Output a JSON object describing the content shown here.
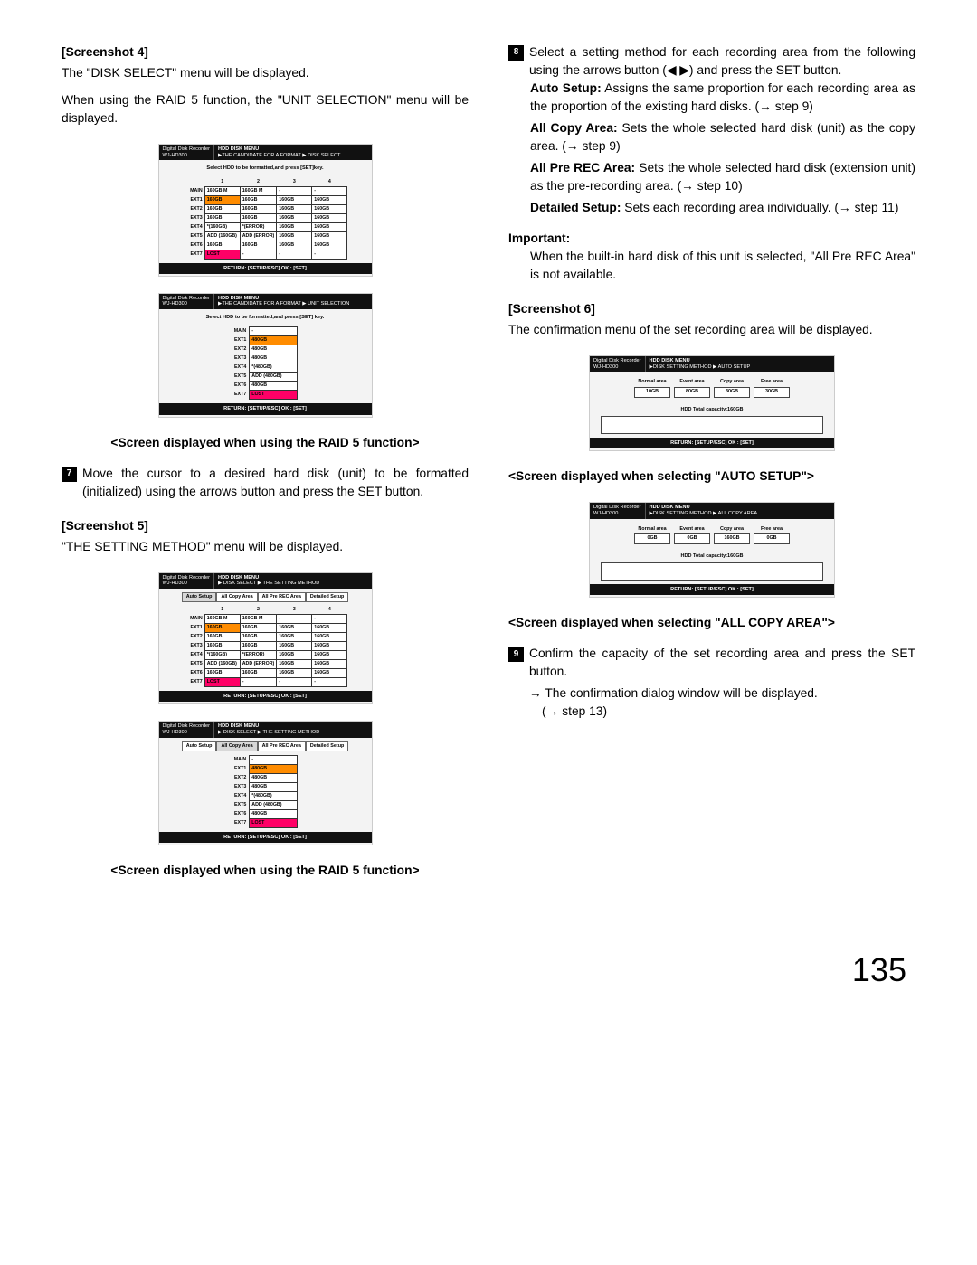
{
  "left": {
    "h4": "[Screenshot 4]",
    "p4a": "The \"DISK SELECT\" menu will be displayed.",
    "p4b": "When using the RAID 5 function, the \"UNIT SELECTION\" menu will be displayed.",
    "caption_raid_a": "<Screen displayed when using the RAID 5 function>",
    "step7": "Move the cursor to a desired hard disk (unit) to be formatted (initialized) using the arrows button and press the SET button.",
    "h5": "[Screenshot 5]",
    "p5": "\"THE SETTING METHOD\" menu will be displayed.",
    "caption_raid_b": "<Screen displayed when using the RAID 5 function>"
  },
  "right": {
    "step8": "Select a setting method for each recording area from the following using the arrows button (◀ ▶) and press the SET button.",
    "defs": {
      "auto": {
        "term": "Auto Setup:",
        "body": " Assigns the same proportion for each recording area as the proportion of the existing hard disks. (→ step 9)"
      },
      "allcopy": {
        "term": "All Copy Area:",
        "body": " Sets the whole selected hard disk (unit) as the copy area. (→ step 9)"
      },
      "allpre": {
        "term": "All Pre REC Area:",
        "body": " Sets the whole selected hard disk (extension unit) as the pre-recording area. (→ step 10)"
      },
      "detailed": {
        "term": "Detailed Setup:",
        "body": " Sets each recording area individually. (→ step 11)"
      }
    },
    "important_label": "Important:",
    "important_body": "When the built-in hard disk of this unit is selected, \"All Pre REC Area\" is not available.",
    "h6": "[Screenshot 6]",
    "p6": "The confirmation menu of the set recording area will be displayed.",
    "caption_auto": "<Screen displayed when selecting \"AUTO SETUP\">",
    "caption_copy": "<Screen displayed when selecting \"ALL COPY AREA\">",
    "step9": "Confirm the capacity of the set recording area and press the SET button.",
    "step9a": "→ The confirmation dialog window will be displayed.",
    "step9b": "(→ step 13)"
  },
  "screens": {
    "common": {
      "rec_label": "Digital Disk Recorder",
      "model": "WJ-HD300",
      "menu_title": "HDD DISK MENU",
      "returnbar": "RETURN: [SETUP/ESC] OK : [SET]"
    },
    "diskselect": {
      "path": "▶THE CANDIDATE FOR A FORMAT ▶ DISK SELECT",
      "instr": "Select HDD to be formatted,and press [SET]key.",
      "cols": [
        "1",
        "2",
        "3",
        "4"
      ],
      "rows": [
        {
          "lbl": "MAIN",
          "cells": [
            {
              "v": "160GB M"
            },
            {
              "v": "160GB M"
            },
            {
              "v": "-"
            },
            {
              "v": "-"
            }
          ]
        },
        {
          "lbl": "EXT1",
          "cells": [
            {
              "v": "160GB",
              "hl": true
            },
            {
              "v": "160GB"
            },
            {
              "v": "160GB"
            },
            {
              "v": "160GB"
            }
          ]
        },
        {
          "lbl": "EXT2",
          "cells": [
            {
              "v": "160GB"
            },
            {
              "v": "160GB"
            },
            {
              "v": "160GB"
            },
            {
              "v": "160GB"
            }
          ]
        },
        {
          "lbl": "EXT3",
          "cells": [
            {
              "v": "160GB"
            },
            {
              "v": "160GB"
            },
            {
              "v": "160GB"
            },
            {
              "v": "160GB"
            }
          ]
        },
        {
          "lbl": "EXT4",
          "cells": [
            {
              "v": "*(160GB)"
            },
            {
              "v": "*(ERROR)"
            },
            {
              "v": "160GB"
            },
            {
              "v": "160GB"
            }
          ]
        },
        {
          "lbl": "EXT5",
          "cells": [
            {
              "v": "ADD (160GB)"
            },
            {
              "v": "ADD (ERROR)"
            },
            {
              "v": "160GB"
            },
            {
              "v": "160GB"
            }
          ]
        },
        {
          "lbl": "EXT6",
          "cells": [
            {
              "v": "160GB"
            },
            {
              "v": "160GB"
            },
            {
              "v": "160GB"
            },
            {
              "v": "160GB"
            }
          ]
        },
        {
          "lbl": "EXT7",
          "cells": [
            {
              "v": "LOST",
              "lost": true
            },
            {
              "v": "-"
            },
            {
              "v": "-"
            },
            {
              "v": "-"
            }
          ]
        }
      ]
    },
    "unitselection": {
      "path": "▶THE CANDIDATE FOR A FORMAT ▶ UNIT SELECTION",
      "instr": "Select HDD to be formatted,and press [SET] key.",
      "rows": [
        {
          "lbl": "MAIN",
          "v": "-",
          "dash": true
        },
        {
          "lbl": "EXT1",
          "v": "480GB",
          "hl": true
        },
        {
          "lbl": "EXT2",
          "v": "480GB"
        },
        {
          "lbl": "EXT3",
          "v": "480GB"
        },
        {
          "lbl": "EXT4",
          "v": "*(480GB)"
        },
        {
          "lbl": "EXT5",
          "v": "ADD (480GB)"
        },
        {
          "lbl": "EXT6",
          "v": "480GB"
        },
        {
          "lbl": "EXT7",
          "v": "LOST",
          "lost": true
        }
      ]
    },
    "setting_tabs": [
      "Auto Setup",
      "All Copy Area",
      "All Pre REC Area",
      "Detailed Setup"
    ],
    "settingmethod": {
      "path": "▶ DISK SELECT ▶ THE SETTING METHOD"
    },
    "settingmethod_unit": {
      "rows": [
        {
          "lbl": "MAIN",
          "v": "-",
          "dash": true
        },
        {
          "lbl": "EXT1",
          "v": "480GB",
          "hl": true
        },
        {
          "lbl": "EXT2",
          "v": "480GB"
        },
        {
          "lbl": "EXT3",
          "v": "480GB"
        },
        {
          "lbl": "EXT4",
          "v": "*(480GB)"
        },
        {
          "lbl": "EXT5",
          "v": "ADD (480GB)"
        },
        {
          "lbl": "EXT6",
          "v": "480GB"
        },
        {
          "lbl": "EXT7",
          "v": "LOST",
          "lost": true
        }
      ]
    },
    "auto_setup": {
      "path": "▶DISK SETTING METHOD  ▶ AUTO SETUP",
      "cols": [
        "Normal area",
        "Event area",
        "Copy area",
        "Free area"
      ],
      "vals": [
        "10GB",
        "80GB",
        "30GB",
        "30GB"
      ],
      "tot": "HDD Total capacity:160GB"
    },
    "all_copy": {
      "path": "▶DISK SETTING METHOD  ▶ ALL COPY AREA",
      "cols": [
        "Normal area",
        "Event area",
        "Copy area",
        "Free area"
      ],
      "vals": [
        "0GB",
        "0GB",
        "160GB",
        "0GB"
      ],
      "tot": "HDD Total capacity:160GB"
    }
  },
  "page_number": "135"
}
